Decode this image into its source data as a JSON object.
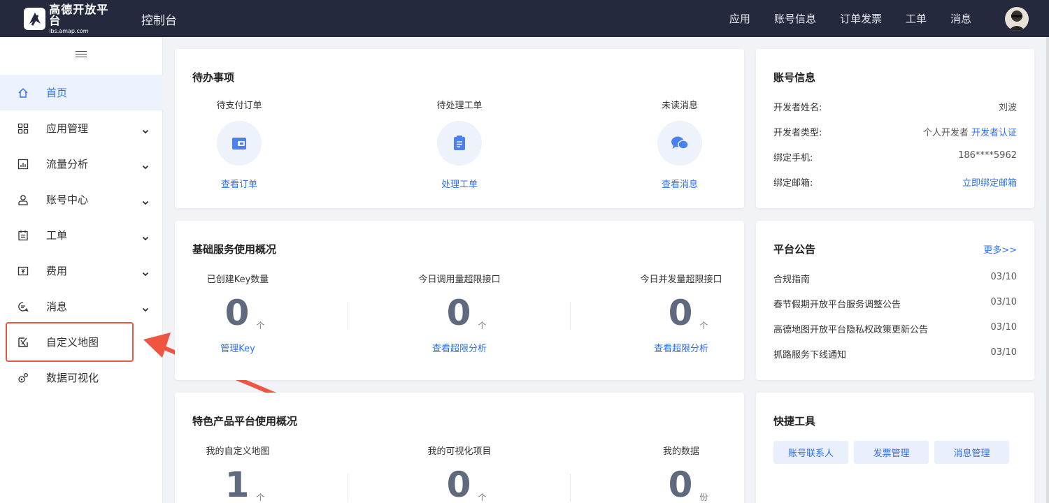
{
  "header": {
    "logo_title": "高德开放平台",
    "logo_url": "lbs.amap.com",
    "console_title": "控制台",
    "nav": [
      "应用",
      "账号信息",
      "订单发票",
      "工单",
      "消息"
    ]
  },
  "sidebar": {
    "items": [
      {
        "label": "首页",
        "icon": "home-icon",
        "expandable": false
      },
      {
        "label": "应用管理",
        "icon": "grid-icon",
        "expandable": true
      },
      {
        "label": "流量分析",
        "icon": "chart-icon",
        "expandable": true
      },
      {
        "label": "账号中心",
        "icon": "user-icon",
        "expandable": true
      },
      {
        "label": "工单",
        "icon": "ticket-icon",
        "expandable": true
      },
      {
        "label": "费用",
        "icon": "fee-icon",
        "expandable": true
      },
      {
        "label": "消息",
        "icon": "message-icon",
        "expandable": true
      },
      {
        "label": "自定义地图",
        "icon": "custom-map-icon",
        "expandable": false
      },
      {
        "label": "数据可视化",
        "icon": "visualization-icon",
        "expandable": false
      }
    ],
    "active_index": 0,
    "highlight_color": "#ee5641"
  },
  "todo": {
    "title": "待办事项",
    "items": [
      {
        "label": "待支付订单",
        "link": "查看订单",
        "icon": "wallet-icon"
      },
      {
        "label": "待处理工单",
        "link": "处理工单",
        "icon": "clipboard-icon"
      },
      {
        "label": "未读消息",
        "link": "查看消息",
        "icon": "chat-icon"
      }
    ]
  },
  "account": {
    "title": "账号信息",
    "rows": [
      {
        "label": "开发者姓名:",
        "value": "刘波"
      },
      {
        "label": "开发者类型:",
        "value": "个人开发者",
        "link": "开发者认证"
      },
      {
        "label": "绑定手机:",
        "value": "186****5962"
      },
      {
        "label": "绑定邮箱:",
        "link": "立即绑定邮箱"
      }
    ]
  },
  "basic": {
    "title": "基础服务使用概况",
    "items": [
      {
        "label": "已创建Key数量",
        "value": "0",
        "unit": "个",
        "link": "管理Key"
      },
      {
        "label": "今日调用量超限接口",
        "value": "0",
        "unit": "个",
        "link": "查看超限分析"
      },
      {
        "label": "今日并发量超限接口",
        "value": "0",
        "unit": "个",
        "link": "查看超限分析"
      }
    ]
  },
  "notice": {
    "title": "平台公告",
    "more": "更多>>",
    "items": [
      {
        "title": "合规指南",
        "date": "03/10"
      },
      {
        "title": "春节假期开放平台服务调整公告",
        "date": "03/10"
      },
      {
        "title": "高德地图开放平台隐私权政策更新公告",
        "date": "03/10"
      },
      {
        "title": "抓路服务下线通知",
        "date": "03/10"
      }
    ]
  },
  "special": {
    "title": "特色产品平台使用概况",
    "items": [
      {
        "label": "我的自定义地图",
        "value": "1",
        "unit": "个"
      },
      {
        "label": "我的可视化项目",
        "value": "0",
        "unit": "个"
      },
      {
        "label": "我的数据",
        "value": "0",
        "unit": "份"
      }
    ]
  },
  "tools": {
    "title": "快捷工具",
    "buttons": [
      "账号联系人",
      "发票管理",
      "消息管理"
    ]
  },
  "colors": {
    "accent": "#2d6ff2",
    "topbar": "#24293e",
    "annotation": "#ee5641"
  }
}
